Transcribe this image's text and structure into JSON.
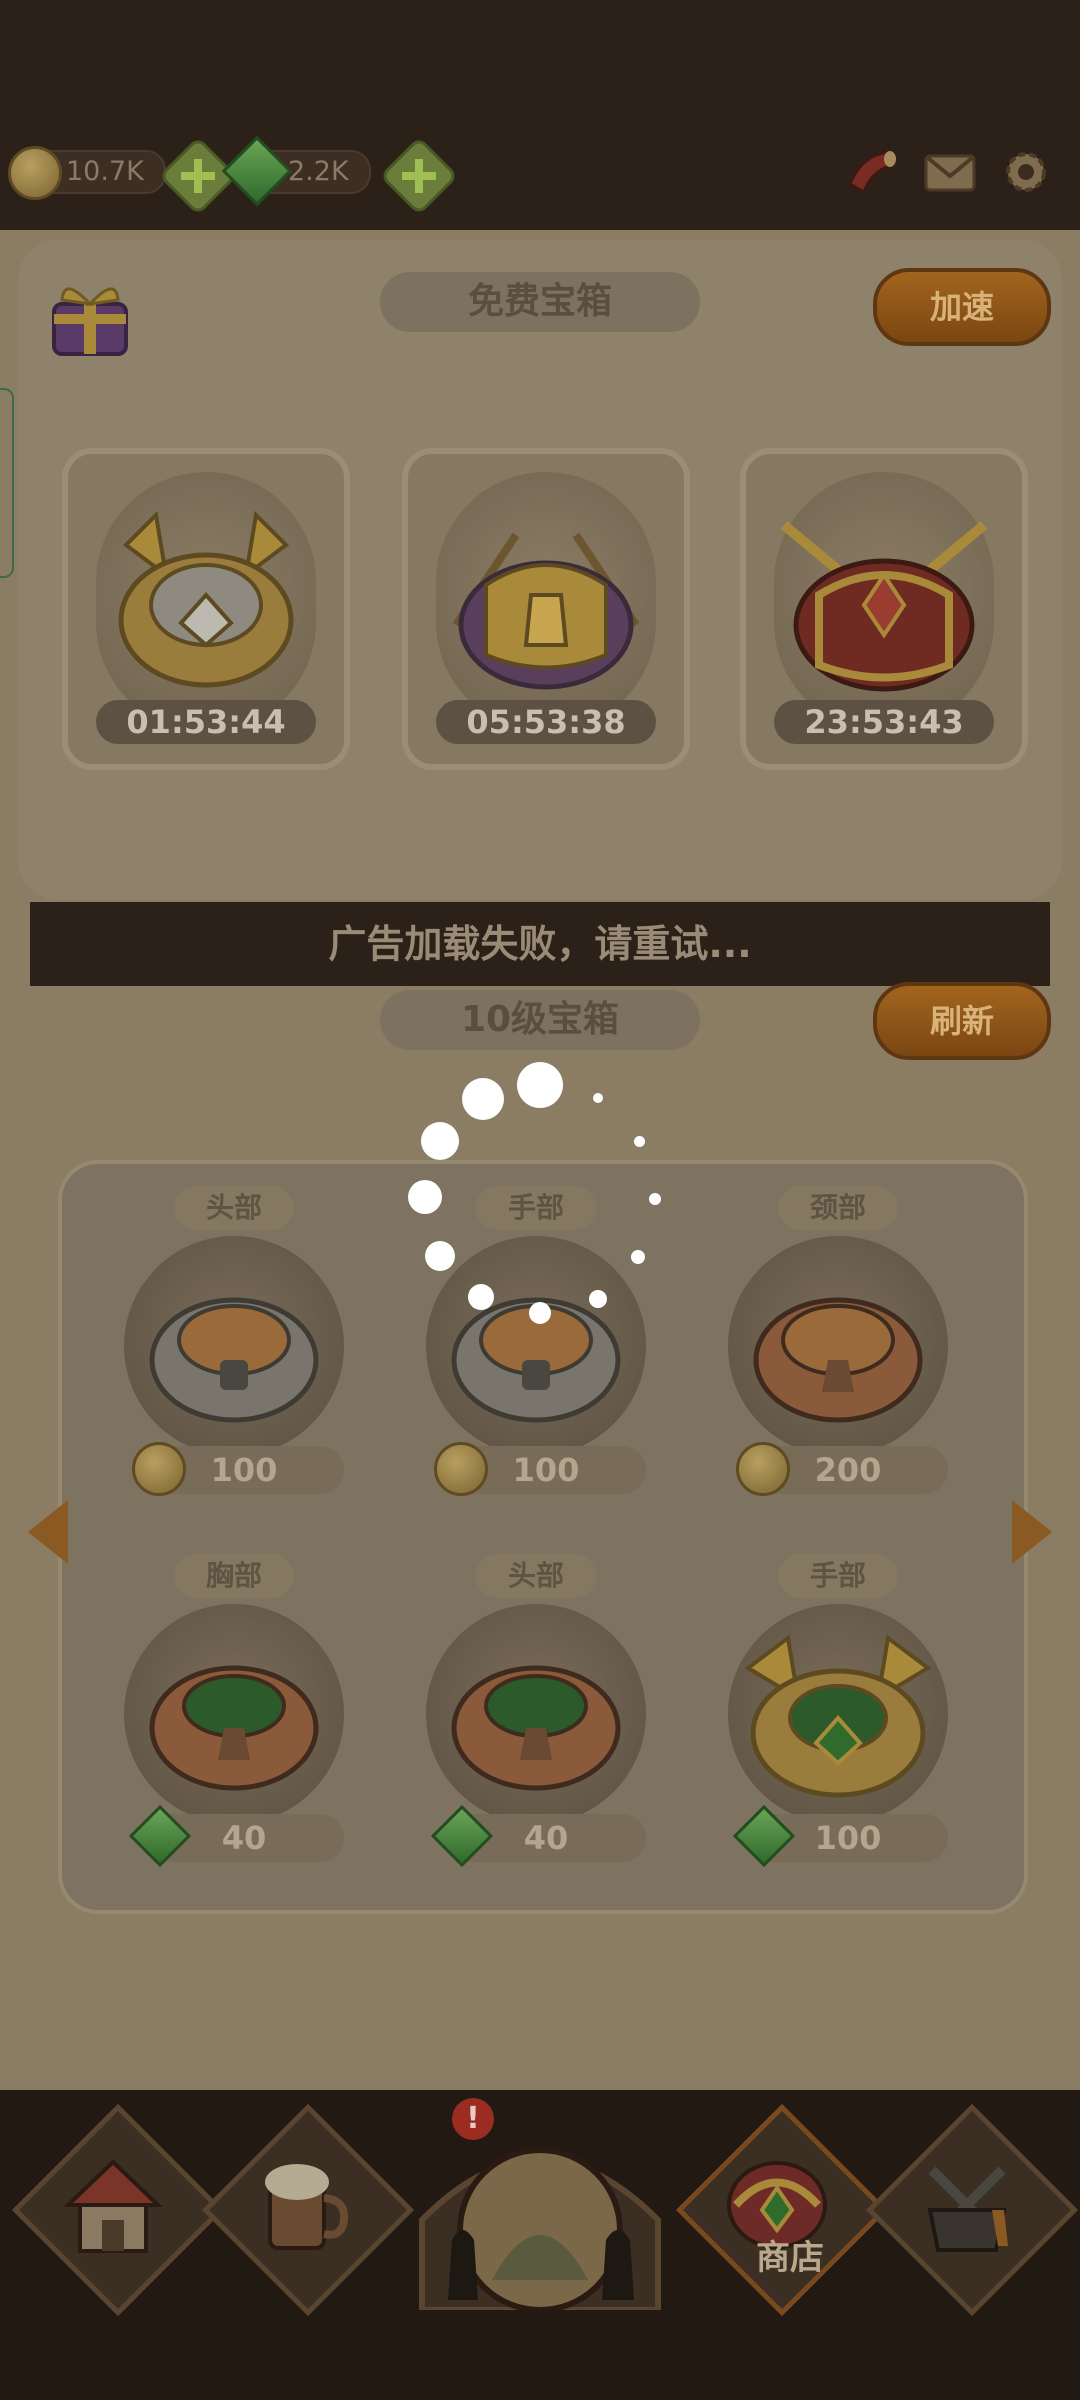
{
  "resources": {
    "gold": "10.7K",
    "gems": "2.2K"
  },
  "free_chests": {
    "title": "免费宝箱",
    "speed_button": "加速",
    "timers": [
      "01:53:44",
      "05:53:38",
      "23:53:43"
    ]
  },
  "ad_message": "广告加载失败，请重试...",
  "level_chests": {
    "title": "10级宝箱",
    "refresh_button": "刷新",
    "items": [
      {
        "label": "头部",
        "price": "100",
        "currency": "gold"
      },
      {
        "label": "手部",
        "price": "100",
        "currency": "gold"
      },
      {
        "label": "颈部",
        "price": "200",
        "currency": "gold"
      },
      {
        "label": "胸部",
        "price": "40",
        "currency": "gem"
      },
      {
        "label": "头部",
        "price": "40",
        "currency": "gem"
      },
      {
        "label": "手部",
        "price": "100",
        "currency": "gem"
      }
    ]
  },
  "nav": {
    "shop_label": "商店",
    "alert_badge": "!"
  },
  "colors": {
    "accent_orange": "#a2651e",
    "overlay_panel": "#8a7d64",
    "spinner": "#ffffff"
  }
}
